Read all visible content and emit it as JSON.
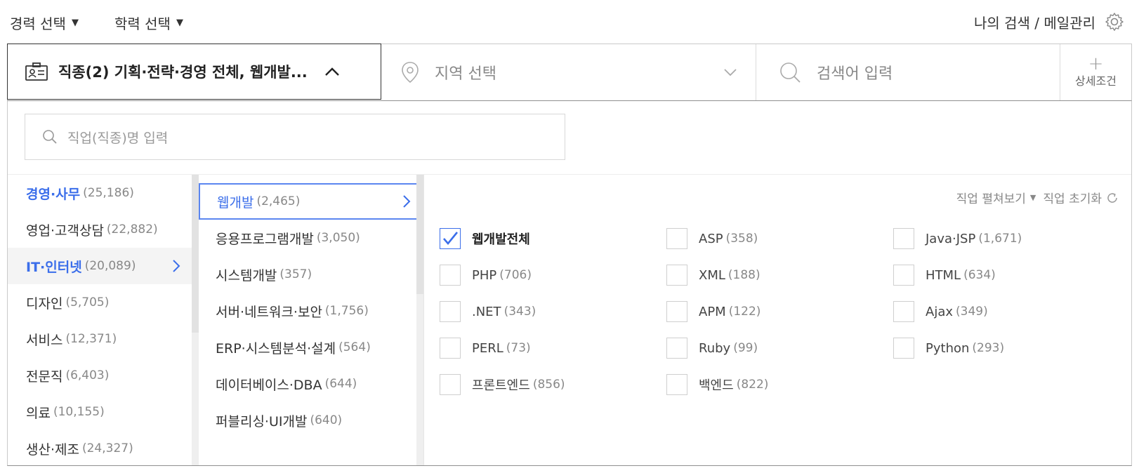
{
  "top": {
    "career_filter": "경력 선택",
    "education_filter": "학력 선택",
    "my_search": "나의 검색 / 메일관리"
  },
  "searchbar": {
    "job_selector": "직종(2) 기획·전략·경영 전체, 웹개발...",
    "location_placeholder": "지역 선택",
    "keyword_placeholder": "검색어 입력",
    "detail_label": "상세조건"
  },
  "panel": {
    "job_search_placeholder": "직업(직종)명 입력",
    "expand_label": "직업 펼쳐보기",
    "reset_label": "직업 초기화",
    "categories": [
      {
        "name": "경영·사무",
        "count": "(25,186)"
      },
      {
        "name": "영업·고객상담",
        "count": "(22,882)"
      },
      {
        "name": "IT·인터넷",
        "count": "(20,089)"
      },
      {
        "name": "디자인",
        "count": "(5,705)"
      },
      {
        "name": "서비스",
        "count": "(12,371)"
      },
      {
        "name": "전문직",
        "count": "(6,403)"
      },
      {
        "name": "의료",
        "count": "(10,155)"
      },
      {
        "name": "생산·제조",
        "count": "(24,327)"
      }
    ],
    "subcategories": [
      {
        "name": "웹개발",
        "count": "(2,465)"
      },
      {
        "name": "응용프로그램개발",
        "count": "(3,050)"
      },
      {
        "name": "시스템개발",
        "count": "(357)"
      },
      {
        "name": "서버·네트워크·보안",
        "count": "(1,756)"
      },
      {
        "name": "ERP·시스템분석·설계",
        "count": "(564)"
      },
      {
        "name": "데이터베이스·DBA",
        "count": "(644)"
      },
      {
        "name": "퍼블리싱·UI개발",
        "count": "(640)"
      }
    ],
    "skills": [
      {
        "name": "웹개발전체",
        "count": "",
        "checked": true
      },
      {
        "name": "ASP",
        "count": "(358)",
        "checked": false
      },
      {
        "name": "Java·JSP",
        "count": "(1,671)",
        "checked": false
      },
      {
        "name": "PHP",
        "count": "(706)",
        "checked": false
      },
      {
        "name": "XML",
        "count": "(188)",
        "checked": false
      },
      {
        "name": "HTML",
        "count": "(634)",
        "checked": false
      },
      {
        "name": ".NET",
        "count": "(343)",
        "checked": false
      },
      {
        "name": "APM",
        "count": "(122)",
        "checked": false
      },
      {
        "name": "Ajax",
        "count": "(349)",
        "checked": false
      },
      {
        "name": "PERL",
        "count": "(73)",
        "checked": false
      },
      {
        "name": "Ruby",
        "count": "(99)",
        "checked": false
      },
      {
        "name": "Python",
        "count": "(293)",
        "checked": false
      },
      {
        "name": "프론트엔드",
        "count": "(856)",
        "checked": false
      },
      {
        "name": "백엔드",
        "count": "(822)",
        "checked": false
      }
    ]
  },
  "colors": {
    "accent": "#3b6eea",
    "text": "#333333",
    "muted": "#888888",
    "border": "#c9c9c9"
  }
}
